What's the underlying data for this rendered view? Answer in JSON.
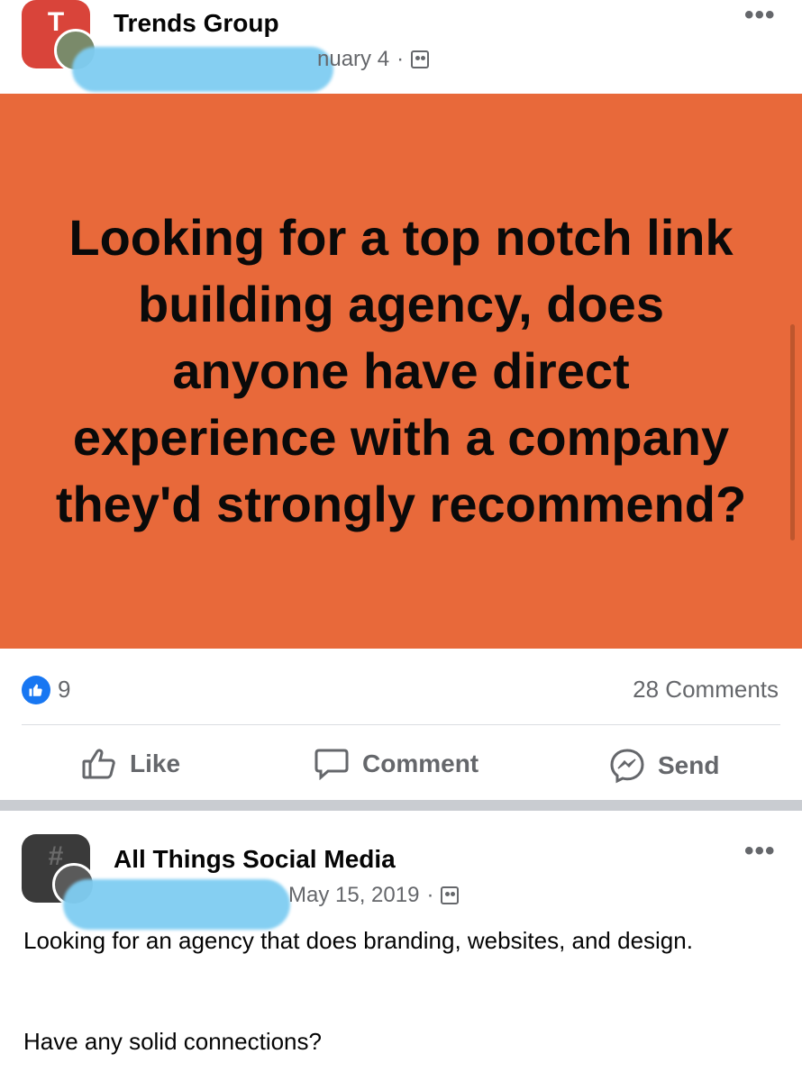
{
  "post1": {
    "group_name": "Trends Group",
    "date_partial": "nuary 4",
    "separator": "·",
    "banner_text": "Looking for a top notch link building agency, does anyone have direct experience with a company they'd strongly recommend?",
    "like_count": "9",
    "comments_count": "28 Comments",
    "actions": {
      "like": "Like",
      "comment": "Comment",
      "send": "Send"
    },
    "avatar_letters": "T",
    "colors": {
      "banner": "#e8693a",
      "like_blue": "#1877f2"
    }
  },
  "post2": {
    "group_name": "All Things Social Media",
    "date": "May 15, 2019",
    "separator": "·",
    "body_line1": "Looking for an agency that does branding, websites, and design.",
    "body_line2": "Have any solid connections?"
  },
  "icons": [
    "more-dots-icon",
    "group-privacy-icon",
    "thumbs-up-icon",
    "comment-bubble-icon",
    "messenger-icon"
  ]
}
